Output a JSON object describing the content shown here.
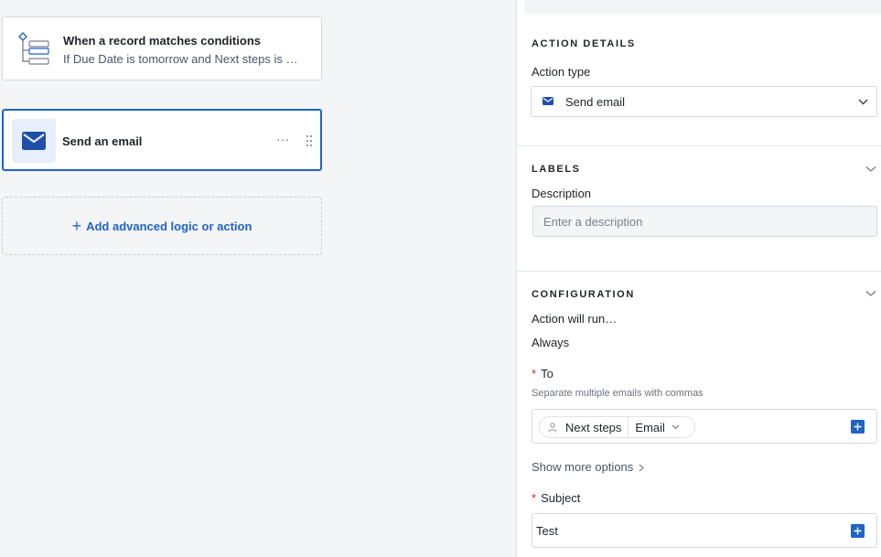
{
  "canvas": {
    "trigger": {
      "title": "When a record matches conditions",
      "subtitle": "If Due Date is tomorrow and Next steps is …",
      "icon": "branch-tree-icon"
    },
    "action": {
      "title": "Send an email",
      "icon": "envelope-icon",
      "more": "···"
    },
    "add": {
      "plus": "+",
      "label": "Add advanced logic or action"
    }
  },
  "panel": {
    "action_details": {
      "title": "ACTION DETAILS",
      "action_type_label": "Action type",
      "action_type_value": "Send email"
    },
    "labels": {
      "title": "LABELS",
      "description_label": "Description",
      "description_placeholder": "Enter a description",
      "description_value": ""
    },
    "configuration": {
      "title": "CONFIGURATION",
      "run_label": "Action will run…",
      "run_value": "Always",
      "to_label": "To",
      "required_mark": "*",
      "to_helper": "Separate multiple emails with commas",
      "to_token": {
        "field": "Next steps",
        "subfield": "Email"
      },
      "show_more": "Show more options",
      "subject_label": "Subject",
      "subject_value": "Test"
    }
  },
  "colors": {
    "accent": "#1f63c6",
    "required": "#c62828",
    "canvas_bg": "#f4f5f7"
  }
}
